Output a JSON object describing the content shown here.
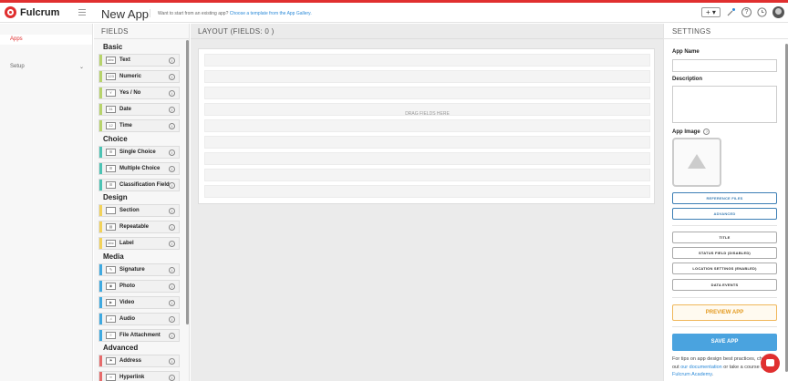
{
  "header": {
    "brand": "Fulcrum",
    "title": "New App",
    "tip_text": "Want to start from an existing app?",
    "tip_link": "Choose a template from the App Gallery.",
    "add_button": "+ ▾"
  },
  "nav": {
    "apps_label": "Apps",
    "setup_label": "Setup",
    "setup_chevron": "⌄"
  },
  "fields": {
    "heading": "FIELDS",
    "categories": {
      "basic": "Basic",
      "choice": "Choice",
      "design": "Design",
      "media": "Media",
      "advanced": "Advanced"
    },
    "items": [
      {
        "label": "Text",
        "icon": "abc"
      },
      {
        "label": "Numeric",
        "icon": "123"
      },
      {
        "label": "Yes / No",
        "icon": "Y"
      },
      {
        "label": "Date",
        "icon": "31"
      },
      {
        "label": "Time",
        "icon": "12"
      },
      {
        "label": "Single Choice",
        "icon": "☰"
      },
      {
        "label": "Multiple Choice",
        "icon": "☰"
      },
      {
        "label": "Classification Field",
        "icon": "☰"
      },
      {
        "label": "Section",
        "icon": ""
      },
      {
        "label": "Repeatable",
        "icon": "▤"
      },
      {
        "label": "Label",
        "icon": "abc"
      },
      {
        "label": "Signature",
        "icon": "✎"
      },
      {
        "label": "Photo",
        "icon": "◉"
      },
      {
        "label": "Video",
        "icon": "▶"
      },
      {
        "label": "Audio",
        "icon": "♫"
      },
      {
        "label": "File Attachment",
        "icon": "≡"
      },
      {
        "label": "Address",
        "icon": "⚑"
      },
      {
        "label": "Hyperlink",
        "icon": "∞"
      }
    ],
    "info_glyph": "i",
    "colors": {
      "basic": "#b7d36b",
      "choice": "#4cc3b4",
      "design": "#f2d25a",
      "media": "#3fa9e0",
      "advanced": "#e66b6b"
    }
  },
  "layout": {
    "heading": "LAYOUT  (FIELDS: 0 )",
    "drop_hint": "DRAG FIELDS HERE"
  },
  "settings": {
    "heading": "SETTINGS",
    "app_name_label": "App Name",
    "app_name_value": "",
    "description_label": "Description",
    "description_value": "",
    "app_image_label": "App Image",
    "help_glyph": "?",
    "buttons": {
      "reference_files": "REFERENCE FILES",
      "advanced": "ADVANCED",
      "title": "TITLE",
      "status_field": "STATUS FIELD (DISABLED)",
      "location_settings": "LOCATION SETTINGS (ENABLED)",
      "data_events": "DATA EVENTS",
      "preview": "PREVIEW APP",
      "save": "SAVE APP"
    },
    "tips": {
      "part1": "For tips on app design best practices, check out ",
      "link1": "our documentation",
      "part2": " or take a course on ",
      "link2": "Fulcrum Academy",
      "part3": "."
    }
  },
  "colors": {
    "brand_red": "#e02f2f",
    "link_blue": "#2c8ad8",
    "save_blue": "#4aa3df",
    "preview_orange": "#e49b22"
  }
}
